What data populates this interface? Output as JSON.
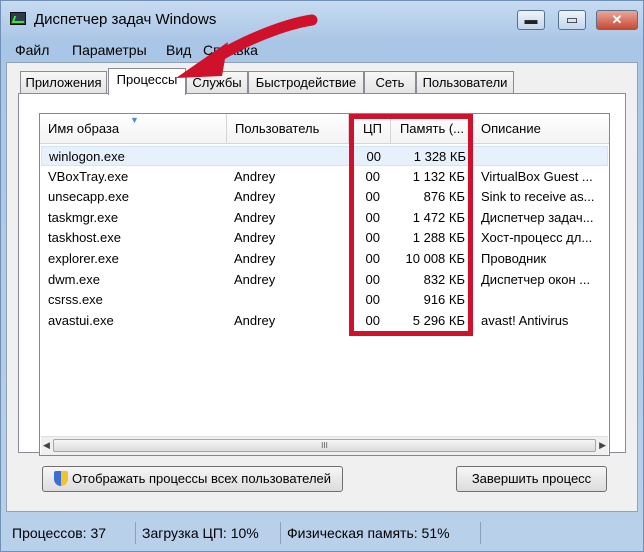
{
  "window": {
    "title": "Диспетчер задач Windows"
  },
  "title_controls": {
    "minimize": "▬",
    "maximize": "▭",
    "close": "✕"
  },
  "menu": [
    {
      "label": "Файл"
    },
    {
      "label": "Параметры"
    },
    {
      "label": "Вид"
    },
    {
      "label": "Справка"
    }
  ],
  "tabs": [
    {
      "label": "Приложения"
    },
    {
      "label": "Процессы"
    },
    {
      "label": "Службы"
    },
    {
      "label": "Быстродействие"
    },
    {
      "label": "Сеть"
    },
    {
      "label": "Пользователи"
    }
  ],
  "active_tab": "Процессы",
  "columns": {
    "image": "Имя образа",
    "user": "Пользователь",
    "cpu": "ЦП",
    "memory": "Память (...",
    "description": "Описание"
  },
  "processes": [
    {
      "image": "winlogon.exe",
      "user": "",
      "cpu": "00",
      "memory": "1 328 КБ",
      "description": ""
    },
    {
      "image": "VBoxTray.exe",
      "user": "Andrey",
      "cpu": "00",
      "memory": "1 132 КБ",
      "description": "VirtualBox Guest ..."
    },
    {
      "image": "unsecapp.exe",
      "user": "Andrey",
      "cpu": "00",
      "memory": "876 КБ",
      "description": "Sink to receive as..."
    },
    {
      "image": "taskmgr.exe",
      "user": "Andrey",
      "cpu": "00",
      "memory": "1 472 КБ",
      "description": "Диспетчер задач..."
    },
    {
      "image": "taskhost.exe",
      "user": "Andrey",
      "cpu": "00",
      "memory": "1 288 КБ",
      "description": "Хост-процесс дл..."
    },
    {
      "image": "explorer.exe",
      "user": "Andrey",
      "cpu": "00",
      "memory": "10 008 КБ",
      "description": "Проводник"
    },
    {
      "image": "dwm.exe",
      "user": "Andrey",
      "cpu": "00",
      "memory": "832 КБ",
      "description": "Диспетчер окон ..."
    },
    {
      "image": "csrss.exe",
      "user": "",
      "cpu": "00",
      "memory": "916 КБ",
      "description": ""
    },
    {
      "image": "avastui.exe",
      "user": "Andrey",
      "cpu": "00",
      "memory": "5 296 КБ",
      "description": "avast! Antivirus"
    }
  ],
  "scrollbar": {
    "left": "◀",
    "right": "▶",
    "grip": "III"
  },
  "buttons": {
    "show_all": "Отображать процессы всех пользователей",
    "end_process": "Завершить процесс"
  },
  "status": {
    "processes": "Процессов: 37",
    "cpu": "Загрузка ЦП: 10%",
    "memory": "Физическая память: 51%"
  },
  "colors": {
    "highlight": "#d0112b",
    "selection": "#e7f1fb"
  }
}
